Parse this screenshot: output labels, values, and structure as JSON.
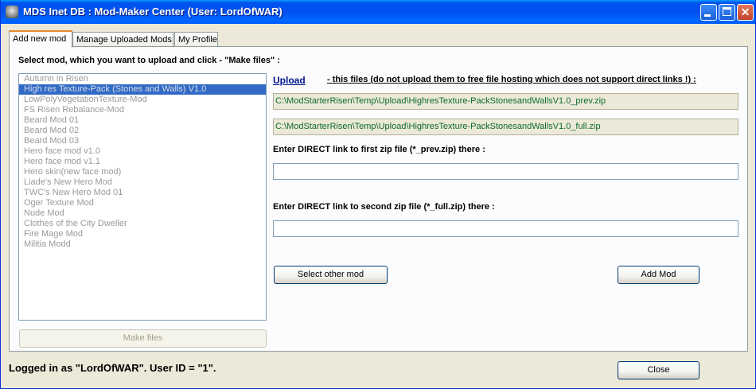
{
  "window": {
    "title": "MDS Inet DB : Mod-Maker Center (User: LordOfWAR)"
  },
  "tabs": [
    {
      "label": "Add new mod",
      "active": true
    },
    {
      "label": "Manage Uploaded Mods",
      "active": false
    },
    {
      "label": "My Profile",
      "active": false
    }
  ],
  "main": {
    "instruction": "Select mod, which you want to upload and click - \"Make files\" :",
    "mods": [
      "Autumn in Risen",
      "High res Texture-Pack (Stones and Walls) V1.0",
      "LowPolyVegetationTexture-Mod",
      "FS Risen Rebalance-Mod",
      "Beard Mod 01",
      "Beard Mod 02",
      "Beard Mod 03",
      "Hero face mod v1.0",
      "Hero face mod v1.1",
      "Hero skin(new face mod)",
      "Liade's New Hero Mod",
      "TWC's New Hero Mod 01",
      "Oger Texture Mod",
      "Nude Mod",
      "Clothes of the City Dweller",
      "Fire Mage Mod",
      "Militia Modd"
    ],
    "selected_index": 1,
    "make_files_label": "Make files",
    "upload_link": "Upload",
    "upload_note": "- this files (do not upload them to free file hosting which does not support direct links !) :",
    "prev_path": "C:\\ModStarterRisen\\Temp\\Upload\\HighresTexture-PackStonesandWallsV1.0_prev.zip",
    "full_path": "C:\\ModStarterRisen\\Temp\\Upload\\HighresTexture-PackStonesandWallsV1.0_full.zip",
    "first_link_label": "Enter DIRECT link to first zip file (*_prev.zip) there :",
    "first_link_value": "",
    "second_link_label": "Enter DIRECT link to second zip file (*_full.zip) there :",
    "second_link_value": "",
    "select_other_label": "Select other mod",
    "add_mod_label": "Add Mod"
  },
  "footer": {
    "status": "Logged in as \"LordOfWAR\". User ID = \"1\".",
    "close_label": "Close"
  },
  "colors": {
    "titlebar": "#0054e3",
    "selection": "#316ac5",
    "path_text": "#0c6b2e",
    "link": "#00138a"
  }
}
